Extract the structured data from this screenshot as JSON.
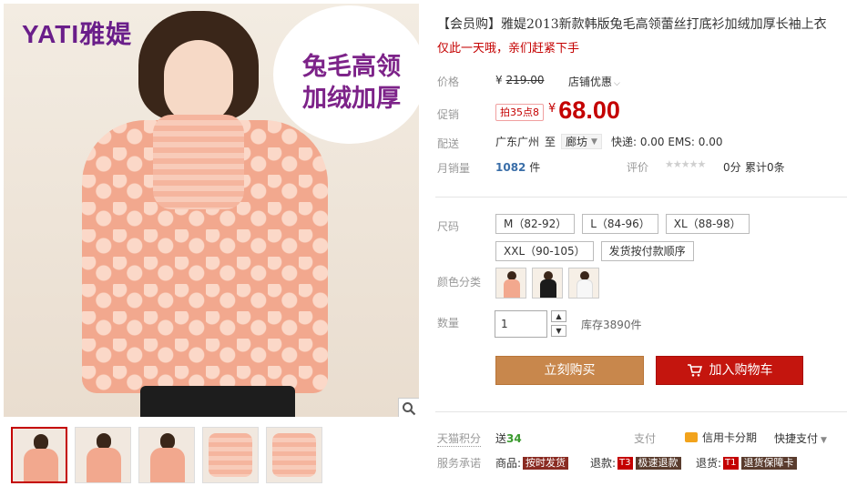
{
  "gallery": {
    "brand": "YATI雅媞",
    "promo_text": "兔毛高领\n加绒加厚",
    "thumbnail_count": 5
  },
  "product": {
    "title": "【会员购】雅媞2013新款韩版兔毛高领蕾丝打底衫加绒加厚长袖上衣",
    "subtitle": "仅此一天哦，亲们赶紧下手"
  },
  "price": {
    "label": "价格",
    "currency": "¥",
    "original": "219.00",
    "shop_promo": "店铺优惠"
  },
  "promo": {
    "label": "促销",
    "badge": "拍35点8",
    "currency": "¥",
    "value": "68.00"
  },
  "shipping": {
    "label": "配送",
    "from": "广东广州",
    "to_word": "至",
    "destination": "廊坊",
    "fees": "快递: 0.00 EMS: 0.00"
  },
  "sales": {
    "label": "月销量",
    "count": "1082",
    "unit": "件",
    "rating_label": "评价",
    "stars": "★★★★★",
    "score": "0分",
    "review_count": "累计0条"
  },
  "size": {
    "label": "尺码",
    "options": [
      "M（82-92）",
      "L（84-96）",
      "XL（88-98）",
      "XXL（90-105）",
      "发货按付款顺序"
    ]
  },
  "color": {
    "label": "颜色分类",
    "swatches": [
      "#f2a88e",
      "#1b1b1b",
      "#f7f7f7"
    ]
  },
  "quantity": {
    "label": "数量",
    "value": "1",
    "up": "▲",
    "down": "▼",
    "stock": "库存3890件"
  },
  "actions": {
    "buy_now": "立刻购买",
    "add_to_cart": "加入购物车"
  },
  "points": {
    "label": "天猫积分",
    "prefix": "送",
    "value": "34"
  },
  "payment": {
    "label": "支付",
    "card": "信用卡分期",
    "quick": "快捷支付"
  },
  "service": {
    "label": "服务承诺",
    "goods_label": "商品:",
    "goods_tag": "按时发货",
    "refund_label": "退款:",
    "refund_code": "T3",
    "refund_tag": "极速退款",
    "return_label": "退货:",
    "return_code": "T1",
    "return_tag": "退货保障卡"
  },
  "colors": {
    "accent_red": "#c40000",
    "buy_button": "#c8874c",
    "cart_button": "#c4150e",
    "brand_purple": "#6a1e8a"
  }
}
